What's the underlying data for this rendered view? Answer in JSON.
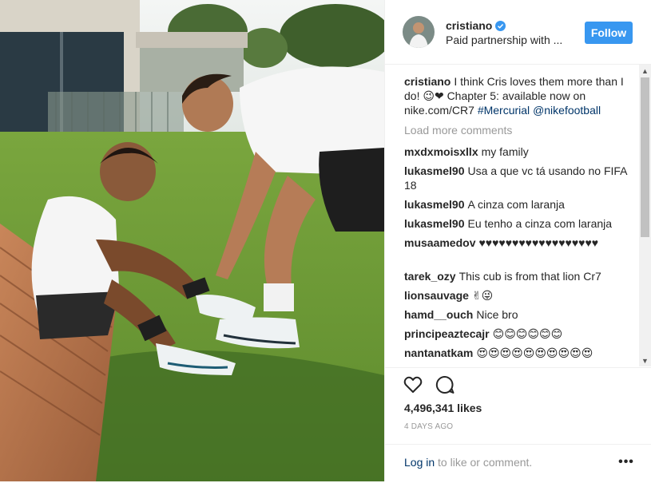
{
  "header": {
    "username": "cristiano",
    "subtitle": "Paid partnership with ...",
    "follow_label": "Follow"
  },
  "caption": {
    "username": "cristiano",
    "text": "I think Cris loves them more than I do! 😉❤ Chapter 5: available now on nike.com/CR7",
    "hashtag": "#Mercurial",
    "mention": "@nikefootball"
  },
  "load_more": "Load more comments",
  "comments": [
    {
      "username": "mxdxmoisxllx",
      "text": "my family"
    },
    {
      "username": "lukasmel90",
      "text": "Usa a que vc tá usando no FIFA 18"
    },
    {
      "username": "lukasmel90",
      "text": "A cinza com laranja"
    },
    {
      "username": "lukasmel90",
      "text": "Eu tenho a cinza com laranja"
    },
    {
      "username": "musaamedov",
      "text": "♥♥♥♥♥♥♥♥♥♥♥♥♥♥♥♥♥♥"
    },
    {
      "username": "tarek_ozy",
      "text": "This cub is from that lion Cr7"
    },
    {
      "username": "lionsauvage",
      "text": "✌😜"
    },
    {
      "username": "hamd__ouch",
      "text": "Nice bro"
    },
    {
      "username": "principeaztecajr",
      "text": "😊😊😊😊😊😊"
    },
    {
      "username": "nantanatkam",
      "text": "😍😍😍😍😍😍😍😍😍😍"
    }
  ],
  "likes": "4,496,341 likes",
  "timestamp": "4 DAYS AGO",
  "login": {
    "link": "Log in",
    "rest": " to like or comment."
  },
  "icons": {
    "like": "heart-icon",
    "comment": "comment-bubble-icon",
    "more": "more-options-icon",
    "verified": "verified-badge-icon"
  },
  "colors": {
    "accent": "#3897f0",
    "link": "#003569",
    "muted": "#999999",
    "text": "#262626"
  }
}
